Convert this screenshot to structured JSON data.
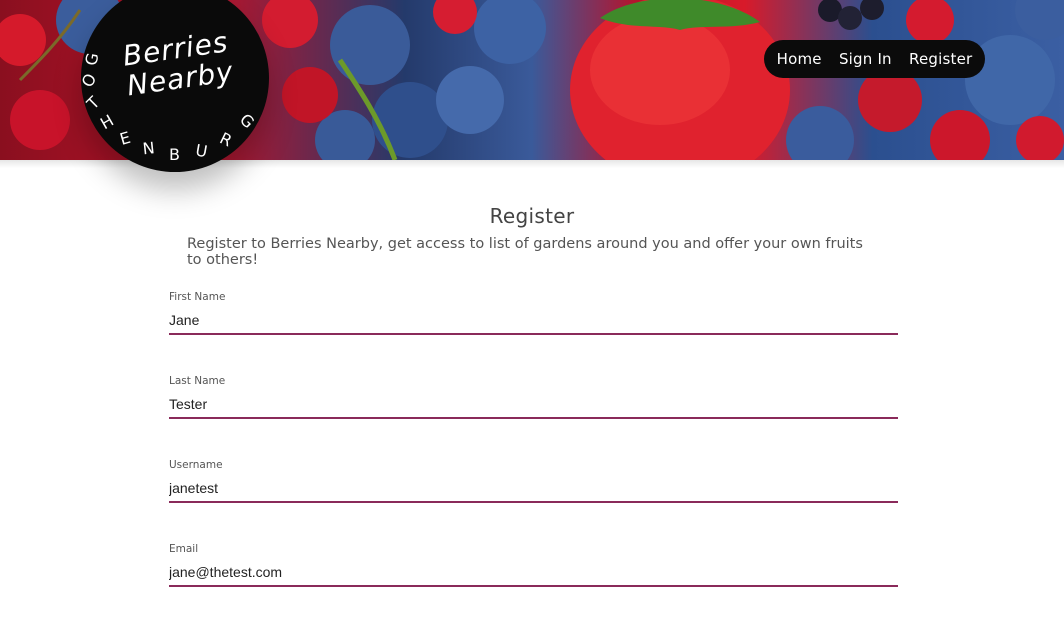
{
  "brand": {
    "name_line1": "Berries",
    "name_line2": "Nearby",
    "city": "GOTHENBURG"
  },
  "nav": {
    "home": "Home",
    "sign_in": "Sign In",
    "register": "Register"
  },
  "page": {
    "title": "Register",
    "intro": "Register to Berries Nearby, get access to list of gardens around you and offer your own fruits to others!"
  },
  "form": {
    "first_name": {
      "label": "First Name",
      "value": "Jane"
    },
    "last_name": {
      "label": "Last Name",
      "value": "Tester"
    },
    "username": {
      "label": "Username",
      "value": "janetest"
    },
    "email": {
      "label": "Email",
      "value": "jane@thetest.com"
    }
  },
  "colors": {
    "field_underline": "#8a2a5a",
    "nav_background": "#0b0b0b",
    "logo_background": "#0a0a0a"
  }
}
